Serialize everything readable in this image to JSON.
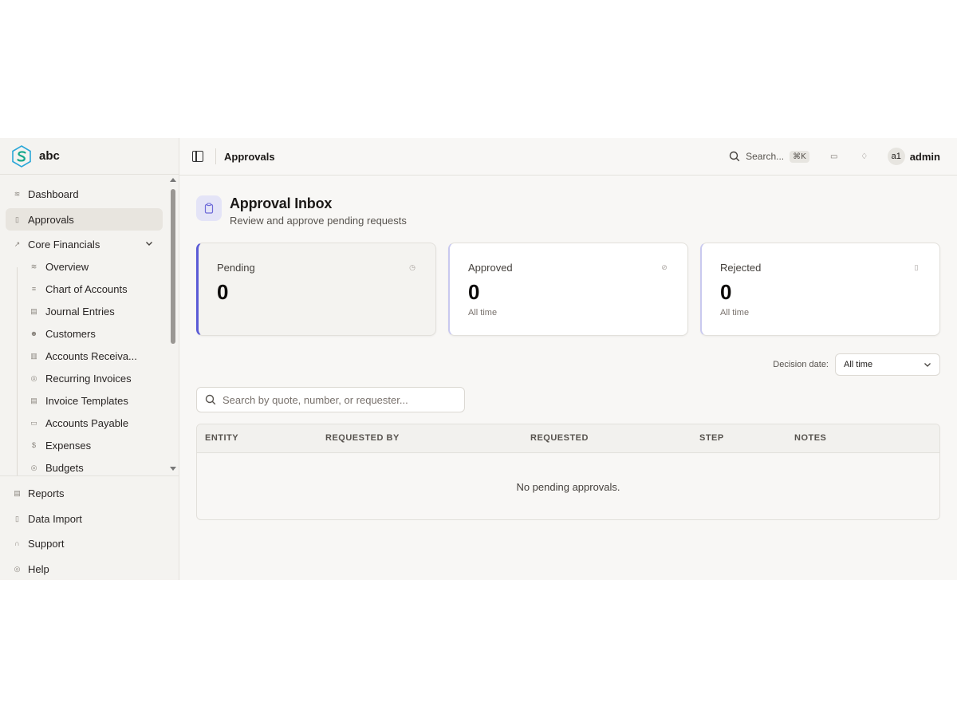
{
  "brand": {
    "name": "abc"
  },
  "sidebar": {
    "items": [
      {
        "label": "Dashboard",
        "icon": "dashboard-icon"
      },
      {
        "label": "Approvals",
        "icon": "clipboard-icon",
        "active": true
      },
      {
        "label": "Core Financials",
        "icon": "trend-icon",
        "expanded": true
      }
    ],
    "sub_items": [
      {
        "label": "Overview",
        "icon": "overview-icon"
      },
      {
        "label": "Chart of Accounts",
        "icon": "ledger-icon"
      },
      {
        "label": "Journal Entries",
        "icon": "journal-icon"
      },
      {
        "label": "Customers",
        "icon": "customers-icon"
      },
      {
        "label": "Accounts Receiva...",
        "icon": "receivable-icon"
      },
      {
        "label": "Recurring Invoices",
        "icon": "recurring-icon"
      },
      {
        "label": "Invoice Templates",
        "icon": "template-icon"
      },
      {
        "label": "Accounts Payable",
        "icon": "payable-icon"
      },
      {
        "label": "Expenses",
        "icon": "expense-icon"
      },
      {
        "label": "Budgets",
        "icon": "budget-icon"
      }
    ],
    "footer": [
      {
        "label": "Reports",
        "icon": "report-icon"
      },
      {
        "label": "Data Import",
        "icon": "import-icon"
      },
      {
        "label": "Support",
        "icon": "headset-icon"
      },
      {
        "label": "Help",
        "icon": "help-icon"
      }
    ]
  },
  "topbar": {
    "breadcrumb": "Approvals",
    "search_label": "Search...",
    "search_shortcut": "⌘K",
    "avatar_initials": "a1",
    "user_name": "admin"
  },
  "page": {
    "title": "Approval Inbox",
    "subtitle": "Review and approve pending requests"
  },
  "cards": [
    {
      "label": "Pending",
      "value": "0",
      "note": ""
    },
    {
      "label": "Approved",
      "value": "0",
      "note": "All time"
    },
    {
      "label": "Rejected",
      "value": "0",
      "note": "All time"
    }
  ],
  "filter": {
    "label": "Decision date:",
    "selected": "All time"
  },
  "search": {
    "placeholder": "Search by quote, number, or requester..."
  },
  "table": {
    "columns": [
      "ENTITY",
      "REQUESTED BY",
      "REQUESTED",
      "STEP",
      "NOTES"
    ],
    "empty_message": "No pending approvals."
  },
  "colors": {
    "accent": "#5b5bd6",
    "sidebar_bg": "#f4f3f0",
    "page_bg": "#f8f7f5"
  }
}
